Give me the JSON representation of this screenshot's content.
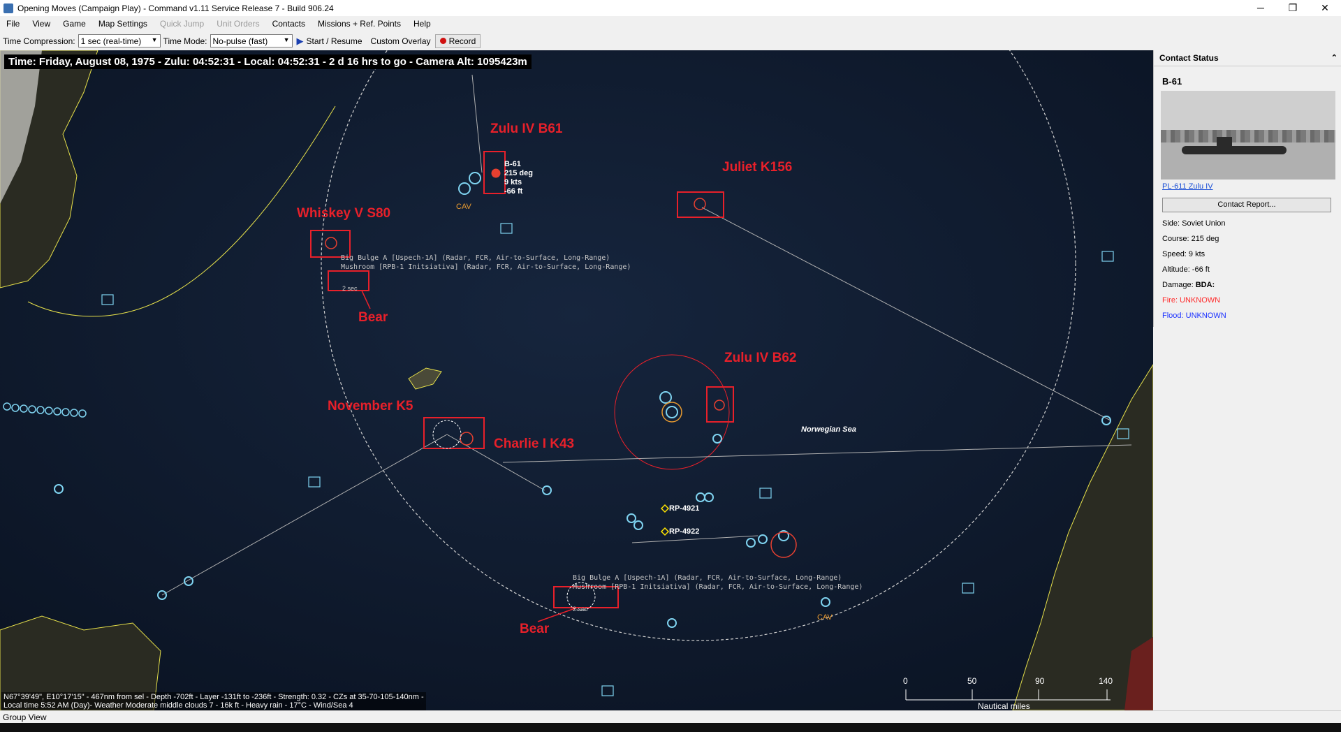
{
  "window": {
    "title": "Opening Moves (Campaign Play) - Command v1.11 Service Release 7 - Build 906.24",
    "minimize": "─",
    "maximize": "❐",
    "close": "✕"
  },
  "menu": [
    {
      "label": "File",
      "enabled": true
    },
    {
      "label": "View",
      "enabled": true
    },
    {
      "label": "Game",
      "enabled": true
    },
    {
      "label": "Map Settings",
      "enabled": true
    },
    {
      "label": "Quick Jump",
      "enabled": false
    },
    {
      "label": "Unit Orders",
      "enabled": false
    },
    {
      "label": "Contacts",
      "enabled": true
    },
    {
      "label": "Missions + Ref. Points",
      "enabled": true
    },
    {
      "label": "Help",
      "enabled": true
    }
  ],
  "toolbar": {
    "time_compression_label": "Time Compression:",
    "time_compression_value": "1 sec (real-time)",
    "time_mode_label": "Time Mode:",
    "time_mode_value": "No-pulse (fast)",
    "start_resume_label": "Start / Resume",
    "custom_overlay_label": "Custom Overlay",
    "record_label": "Record"
  },
  "map": {
    "time_bar": "Time: Friday, August 08, 1975 - Zulu: 04:52:31 - Local: 04:52:31 - 2 d 16 hrs to go -  Camera Alt: 1095423m",
    "annotations": {
      "zulu_b61": "Zulu IV B61",
      "juliet": "Juliet K156",
      "whiskey": "Whiskey V S80",
      "bear_1": "Bear",
      "zulu_b62": "Zulu IV B62",
      "november": "November K5",
      "charlie": "Charlie I K43",
      "bear_2": "Bear"
    },
    "unit_info": [
      "B-61",
      "215 deg",
      "9 kts",
      "-66 ft"
    ],
    "cav_1": "CAV",
    "cav_2": "CAV",
    "sensor_top_1": "Big Bulge A [Uspech-1A] (Radar, FCR, Air-to-Surface, Long-Range)",
    "sensor_top_2": "Mushroom [RPB-1 Initsiativa] (Radar, FCR, Air-to-Surface, Long-Range)",
    "sensor_bottom_1": "Big Bulge A [Uspech-1A] (Radar, FCR, Air-to-Surface, Long-Range)",
    "sensor_bottom_2": "Mushroom [RPB-1 Initsiativa] (Radar, FCR, Air-to-Surface, Long-Range)",
    "bear_partial_1": "2 sec",
    "bear_partial_2": "2 sec",
    "sea_label": "Norwegian Sea",
    "rp_1": "RP-4921",
    "rp_2": "RP-4922",
    "status_line_1": "N67°39'49\", E10°17'15\" - 467nm from sel - Depth -702ft - Layer -131ft to -236ft - Strength: 0.32 - CZs at 35-70-105-140nm -",
    "status_line_2": "Local time 5:52 AM (Day)- Weather Moderate middle clouds 7 - 16k ft - Heavy rain - 17°C - Wind/Sea 4",
    "scale": {
      "ticks": [
        "0",
        "50",
        "90",
        "140"
      ],
      "unit": "Nautical miles"
    }
  },
  "contact_status": {
    "header": "Contact Status",
    "collapse_glyph": "⌃",
    "unit_name": "B-61",
    "class_link": "PL-611 Zulu IV",
    "contact_report_button": "Contact Report...",
    "side": "Side: Soviet Union",
    "course": "Course: 215 deg",
    "speed": "Speed: 9 kts",
    "altitude": "Altitude: -66 ft",
    "damage_label": "Damage:",
    "damage_value": "BDA:",
    "fire": "Fire: UNKNOWN",
    "flood": "Flood: UNKNOWN"
  },
  "statusbar": {
    "text": "Group View"
  },
  "colors": {
    "annotation_red": "#e8202a",
    "map_sea": "#0f1a2c",
    "coast_yellow": "#e6e04a",
    "contact_cyan": "#7fd3f0",
    "fire_red": "#ff2a2a",
    "flood_blue": "#1a30ff",
    "link_blue": "#1a4fd6"
  }
}
